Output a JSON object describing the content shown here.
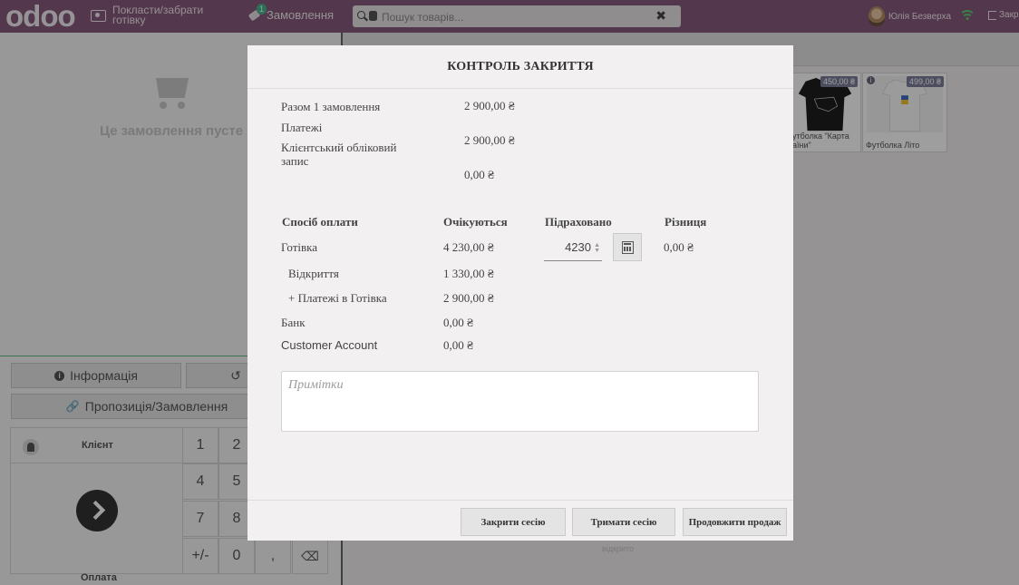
{
  "header": {
    "logo": "odoo",
    "cash_in_out": "Покласти/забрати готівку",
    "orders_label": "Замовлення",
    "orders_badge": "1",
    "search_placeholder": "Пошук товарів...",
    "clear_glyph": "✖",
    "user_name": "Юлія Безверха",
    "close_label": "Закр"
  },
  "left_panel": {
    "empty_order": "Це замовлення пусте",
    "info_button": "Інформація",
    "refund_glyph": "↺",
    "proposal_button": "Пропозиція/Замовлення",
    "client_label": "Клієнт",
    "pay_label": "Оплата",
    "keys": [
      "1",
      "2",
      "4",
      "5",
      "7",
      "8",
      "+/-",
      "0",
      ","
    ]
  },
  "products": [
    {
      "name": "утболка \"Карта аїни\"",
      "price": "450,00 ₴"
    },
    {
      "name": "Футболка Літо",
      "price": "499,00 ₴"
    }
  ],
  "background_faded_text": "відкрито",
  "modal": {
    "title": "КОНТРОЛЬ ЗАКРИТТЯ",
    "summary": {
      "total_orders_label": "Разом 1 замовлення",
      "total_orders_value": "2 900,00 ₴",
      "payments_label": "Платежі",
      "client_account_label": "Клієнтський обліковий запис",
      "client_account_value": "2 900,00 ₴",
      "extra_value": "0,00 ₴"
    },
    "table": {
      "headers": {
        "method": "Спосіб оплати",
        "expected": "Очікуються",
        "counted": "Підраховано",
        "difference": "Різниця"
      },
      "cash": {
        "name": "Готівка",
        "expected": "4 230,00 ₴",
        "counted": "4230",
        "difference": "0,00 ₴"
      },
      "opening": {
        "name": "Відкриття",
        "expected": "1 330,00 ₴"
      },
      "cash_payments": {
        "name": "+ Платежі в Готівка",
        "expected": "2 900,00 ₴"
      },
      "bank": {
        "name": "Банк",
        "expected": "0,00 ₴"
      },
      "customer_account": {
        "name": "Customer Account",
        "expected": "0,00 ₴"
      }
    },
    "notes_placeholder": "Примітки",
    "buttons": {
      "close_session": "Закрити сесію",
      "keep_session": "Тримати сесію",
      "continue_selling": "Продовжити продаж"
    }
  },
  "colors": {
    "brand": "#875a7b",
    "overlay": "rgba(0,0,0,0.38)",
    "modal_bg": "#f2f0f1",
    "wifi": "#5ecf6e"
  }
}
